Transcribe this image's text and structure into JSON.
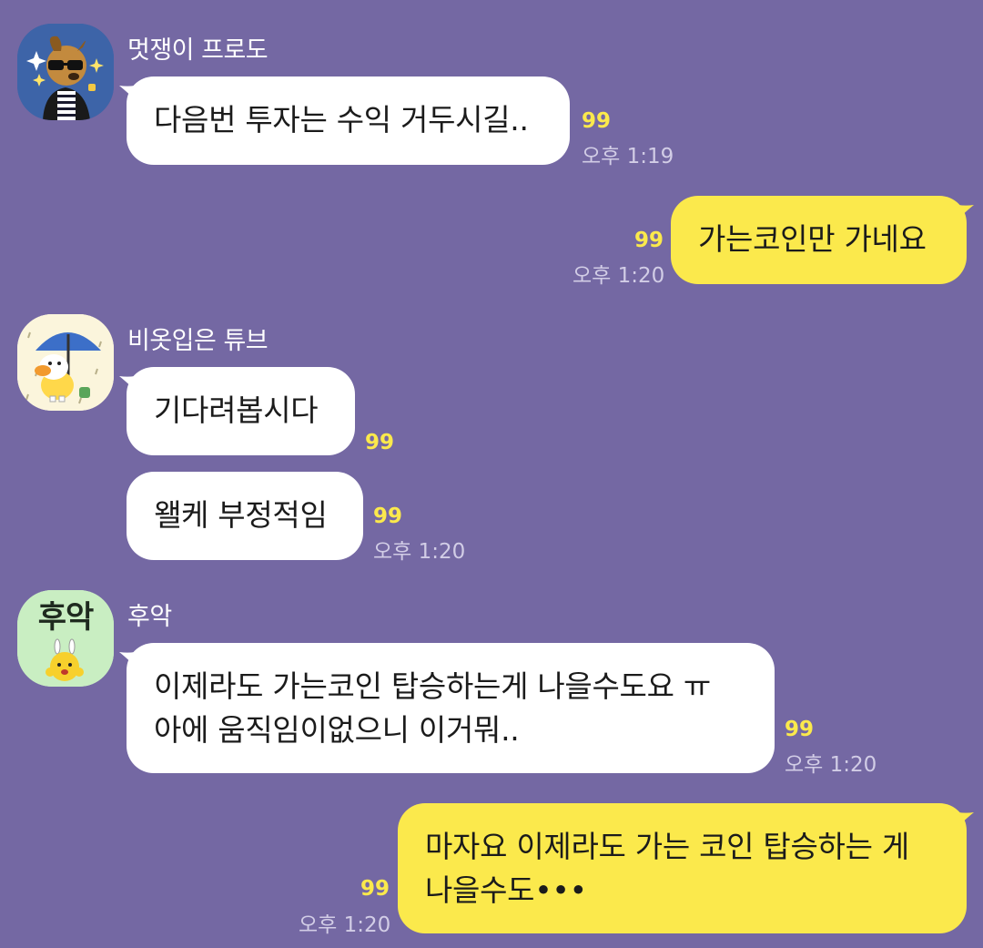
{
  "chat": {
    "background_color": "#7468a3",
    "incoming_bubble_color": "#ffffff",
    "outgoing_bubble_color": "#fbe94c",
    "unread_color": "#fbe94c",
    "messages": [
      {
        "sender": "멋쟁이 프로도",
        "avatar_icon": "frodo-dog-with-sunglasses-icon",
        "bubbles": [
          {
            "text": "다음번 투자는 수익 거두시길..",
            "unread": "99",
            "time": "오후 1:19"
          }
        ]
      },
      {
        "sender": "",
        "outgoing": true,
        "bubbles": [
          {
            "text": "가는코인만 가네요",
            "unread": "99",
            "time": "오후 1:20"
          }
        ]
      },
      {
        "sender": "비옷입은 튜브",
        "avatar_icon": "tube-duck-with-umbrella-icon",
        "bubbles": [
          {
            "text": "기다려봅시다",
            "unread": "99",
            "time": ""
          },
          {
            "text": "왤케 부정적임",
            "unread": "99",
            "time": "오후 1:20"
          }
        ]
      },
      {
        "sender": "후악",
        "avatar_icon": "fried-egg-bunny-icon",
        "avatar_text": "후악",
        "bubbles": [
          {
            "text_lines": [
              "이제라도 가는코인 탑승하는게 나을수도요 ㅠ",
              "아에 움직임이없으니 이거뭐.."
            ],
            "unread": "99",
            "time": "오후 1:20"
          }
        ]
      },
      {
        "sender": "",
        "outgoing": true,
        "bubbles": [
          {
            "text_lines": [
              "마자요 이제라도 가는 코인 탑승하는 게",
              "나을수도•••"
            ],
            "unread": "99",
            "time": "오후 1:20"
          }
        ]
      }
    ]
  }
}
